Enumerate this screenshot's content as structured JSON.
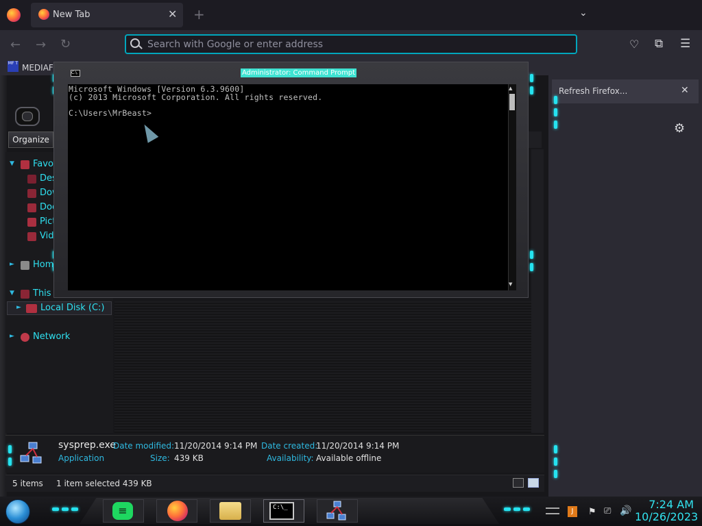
{
  "firefox": {
    "tab": {
      "label": "New Tab"
    },
    "urlbar": {
      "placeholder": "Search with Google or enter address"
    },
    "bookmark": {
      "label": "MEDIAFI",
      "icon_text": "MF T"
    },
    "refresh_notice": {
      "label": "Refresh Firefox..."
    },
    "icons": [
      "firefox-logo-icon",
      "close-icon",
      "plus-icon",
      "chevron-down-icon",
      "back-icon",
      "forward-icon",
      "reload-icon",
      "search-icon",
      "pocket-icon",
      "extensions-icon",
      "menu-icon",
      "gear-icon"
    ]
  },
  "cmd": {
    "title": "Administrator: Command Prompt",
    "title_icon_text": "C:\\.",
    "lines": [
      "Microsoft Windows [Version 6.3.9600]",
      "(c) 2013 Microsoft Corporation. All rights reserved.",
      "C:\\Users\\MrBeast>"
    ]
  },
  "explorer": {
    "organize_label": "Organize",
    "nav": [
      {
        "label": "Favori",
        "name": "nav-favorites"
      },
      {
        "label": "Desk",
        "name": "nav-desktop"
      },
      {
        "label": "Dow",
        "name": "nav-downloads"
      },
      {
        "label": "Doc",
        "name": "nav-documents"
      },
      {
        "label": "Pict",
        "name": "nav-pictures"
      },
      {
        "label": "Vide",
        "name": "nav-videos"
      },
      {
        "label": "Home",
        "name": "nav-homegroup"
      },
      {
        "label": "This P",
        "name": "nav-this-pc"
      },
      {
        "label": "Local Disk (C:)",
        "name": "nav-local-disk"
      },
      {
        "label": "Network",
        "name": "nav-network"
      }
    ],
    "details": {
      "filename": "sysprep.exe",
      "type": "Application",
      "date_modified_label": "Date modified:",
      "date_modified": "11/20/2014 9:14 PM",
      "size_label": "Size:",
      "size": "439 KB",
      "date_created_label": "Date created:",
      "date_created": "11/20/2014 9:14 PM",
      "availability_label": "Availability:",
      "availability": "Available offline"
    },
    "status": {
      "items": "5 items",
      "selected": "1 item selected  439 KB"
    }
  },
  "taskbar": {
    "apps": [
      "spotify-icon",
      "firefox-icon",
      "file-explorer-icon",
      "command-prompt-icon",
      "network-icon"
    ],
    "cmd_icon_text": "C:\\_",
    "spotify_glyph": "≡",
    "tray_app_glyph": "J",
    "clock": {
      "time": "7:24 AM",
      "date": "10/26/2023"
    }
  },
  "colors": {
    "accent_cyan": "#25e3f0",
    "firefox_focus": "#00a7bd",
    "cmd_title_bg": "#3fe3d2"
  }
}
